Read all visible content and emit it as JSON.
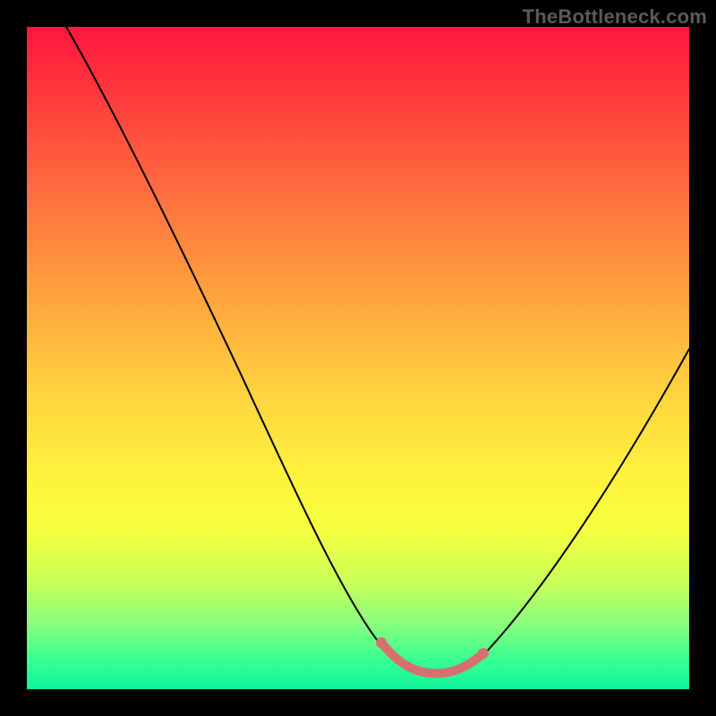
{
  "watermark": "TheBottleneck.com",
  "colors": {
    "background": "#000000",
    "curve": "#000000",
    "highlight": "#d6706e",
    "gradient_top": "#ff1440",
    "gradient_bottom": "#10f59b"
  },
  "chart_data": {
    "type": "line",
    "title": "",
    "xlabel": "",
    "ylabel": "",
    "xlim": [
      0,
      100
    ],
    "ylim": [
      0,
      100
    ],
    "annotations": [
      "TheBottleneck.com"
    ],
    "series": [
      {
        "name": "bottleneck-curve",
        "x": [
          6,
          10,
          15,
          20,
          25,
          30,
          35,
          40,
          45,
          50,
          54,
          58,
          62,
          66,
          70,
          75,
          80,
          85,
          90,
          95,
          100
        ],
        "values": [
          100,
          93,
          84,
          75,
          66,
          57,
          48,
          39,
          30,
          20,
          12,
          6,
          3,
          3,
          6,
          14,
          22,
          30,
          38,
          45,
          51
        ]
      },
      {
        "name": "optimal-highlight",
        "x": [
          53,
          56,
          60,
          64,
          68,
          70
        ],
        "values": [
          8,
          5,
          3,
          3,
          5,
          8
        ]
      }
    ]
  }
}
